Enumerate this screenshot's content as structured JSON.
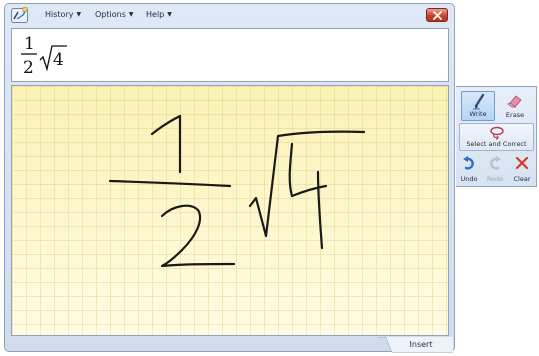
{
  "menubar": {
    "items": [
      {
        "label": "History"
      },
      {
        "label": "Options"
      },
      {
        "label": "Help"
      }
    ]
  },
  "preview": {
    "numerator": "1",
    "denominator": "2",
    "radicand": "4"
  },
  "tools": {
    "write": {
      "label": "Write",
      "active": true
    },
    "erase": {
      "label": "Erase"
    },
    "select_correct": {
      "label": "Select and Correct"
    },
    "undo": {
      "label": "Undo"
    },
    "redo": {
      "label": "Redo",
      "enabled": false
    },
    "clear": {
      "label": "Clear"
    }
  },
  "insert": {
    "label": "Insert"
  },
  "icons": {
    "app": "math-input-icon",
    "close": "close-icon",
    "write": "pen-icon",
    "erase": "eraser-icon",
    "select": "lasso-icon",
    "undo": "undo-icon",
    "redo": "redo-icon",
    "clear": "clear-x-icon"
  },
  "colors": {
    "writing_area": "#fdf7cf",
    "ink": "#1a1a1a",
    "close_button": "#c8452f",
    "clear_icon": "#d23a2a",
    "undo_icon": "#2f6fc4"
  }
}
